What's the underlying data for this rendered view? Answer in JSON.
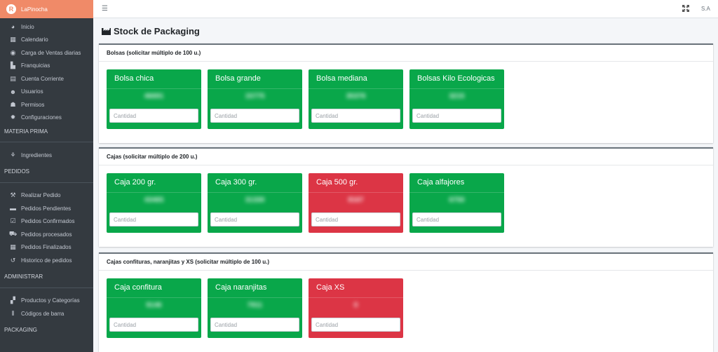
{
  "brand": {
    "name": "LaPinocha",
    "logo_letter": "R"
  },
  "sidebar": {
    "top_items": [
      {
        "label": "Inicio",
        "icon": "palette-icon"
      },
      {
        "label": "Calendario",
        "icon": "calendar-icon"
      },
      {
        "label": "Carga de Ventas diarias",
        "icon": "coins-icon"
      },
      {
        "label": "Franquicias",
        "icon": "industry-icon"
      },
      {
        "label": "Cuenta Corriente",
        "icon": "file-invoice-icon"
      },
      {
        "label": "Usuarios",
        "icon": "users-icon"
      },
      {
        "label": "Permisos",
        "icon": "user-lock-icon"
      },
      {
        "label": "Configuraciones",
        "icon": "gear-icon"
      }
    ],
    "section_materia_prima": "MATERIA PRIMA",
    "materia_items": [
      {
        "label": "Ingredientes",
        "icon": "seedling-icon"
      }
    ],
    "section_pedidos": "PEDIDOS",
    "pedidos_items": [
      {
        "label": "Realizar Pedido",
        "icon": "people-carry-icon"
      },
      {
        "label": "Pedidos Pendientes",
        "icon": "shipping-icon"
      },
      {
        "label": "Pedidos Confirmados",
        "icon": "check-square-icon"
      },
      {
        "label": "Pedidos procesados",
        "icon": "truck-loading-icon"
      },
      {
        "label": "Pedidos Finalizados",
        "icon": "calendar-check-icon"
      },
      {
        "label": "Historico de pedidos",
        "icon": "history-icon"
      }
    ],
    "section_administrar": "ADMINISTRAR",
    "admin_items": [
      {
        "label": "Productos y Categorías",
        "icon": "boxes-icon"
      },
      {
        "label": "Códigos de barra",
        "icon": "barcode-icon"
      }
    ],
    "section_packaging": "PACKAGING"
  },
  "topbar": {
    "user_initials": "S.A"
  },
  "page": {
    "title": "Stock de Packaging"
  },
  "sections": [
    {
      "title": "Bolsas (solicitar múltiplo de 100 u.)",
      "items": [
        {
          "name": "Bolsa chica",
          "value": "46691",
          "status": "ok"
        },
        {
          "name": "Bolsa grande",
          "value": "15775",
          "status": "ok"
        },
        {
          "name": "Bolsa mediana",
          "value": "35376",
          "status": "ok"
        },
        {
          "name": "Bolsas Kilo Ecologicas",
          "value": "3215",
          "status": "ok"
        }
      ]
    },
    {
      "title": "Cajas (solicitar múltiplo de 200 u.)",
      "items": [
        {
          "name": "Caja 200 gr.",
          "value": "43465",
          "status": "ok"
        },
        {
          "name": "Caja 300 gr.",
          "value": "31330",
          "status": "ok"
        },
        {
          "name": "Caja 500 gr.",
          "value": "8167",
          "status": "low"
        },
        {
          "name": "Caja alfajores",
          "value": "6750",
          "status": "ok"
        }
      ]
    },
    {
      "title": "Cajas confituras, naranjitas y XS (solicitar múltiplo de 100 u.)",
      "items": [
        {
          "name": "Caja confitura",
          "value": "9146",
          "status": "ok"
        },
        {
          "name": "Caja naranjitas",
          "value": "7911",
          "status": "ok"
        },
        {
          "name": "Caja XS",
          "value": "0",
          "status": "low"
        }
      ]
    }
  ],
  "input_placeholder": "Cantidad",
  "colors": {
    "ok": "#09a74a",
    "low": "#dc3545",
    "brand": "#f08a68",
    "sidebar": "#343a40"
  }
}
